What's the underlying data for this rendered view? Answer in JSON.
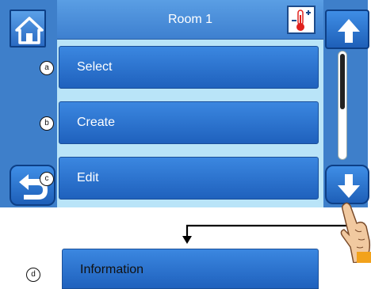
{
  "header": {
    "title": "Room 1"
  },
  "icons": {
    "home": "home-icon",
    "back": "back-arrow-icon",
    "up": "arrow-up-icon",
    "down": "arrow-down-icon",
    "temperature": "thermometer-plus-minus-icon",
    "pointer": "hand-pointer-icon"
  },
  "menu": {
    "items": [
      {
        "label": "Select",
        "marker": "a"
      },
      {
        "label": "Create",
        "marker": "b"
      },
      {
        "label": "Edit",
        "marker": "c"
      }
    ]
  },
  "next_item": {
    "label": "Information",
    "marker": "d"
  },
  "colors": {
    "button_blue": "#1f61bd",
    "screen_light": "#b9e4f8",
    "temp_red": "#e0201c"
  }
}
